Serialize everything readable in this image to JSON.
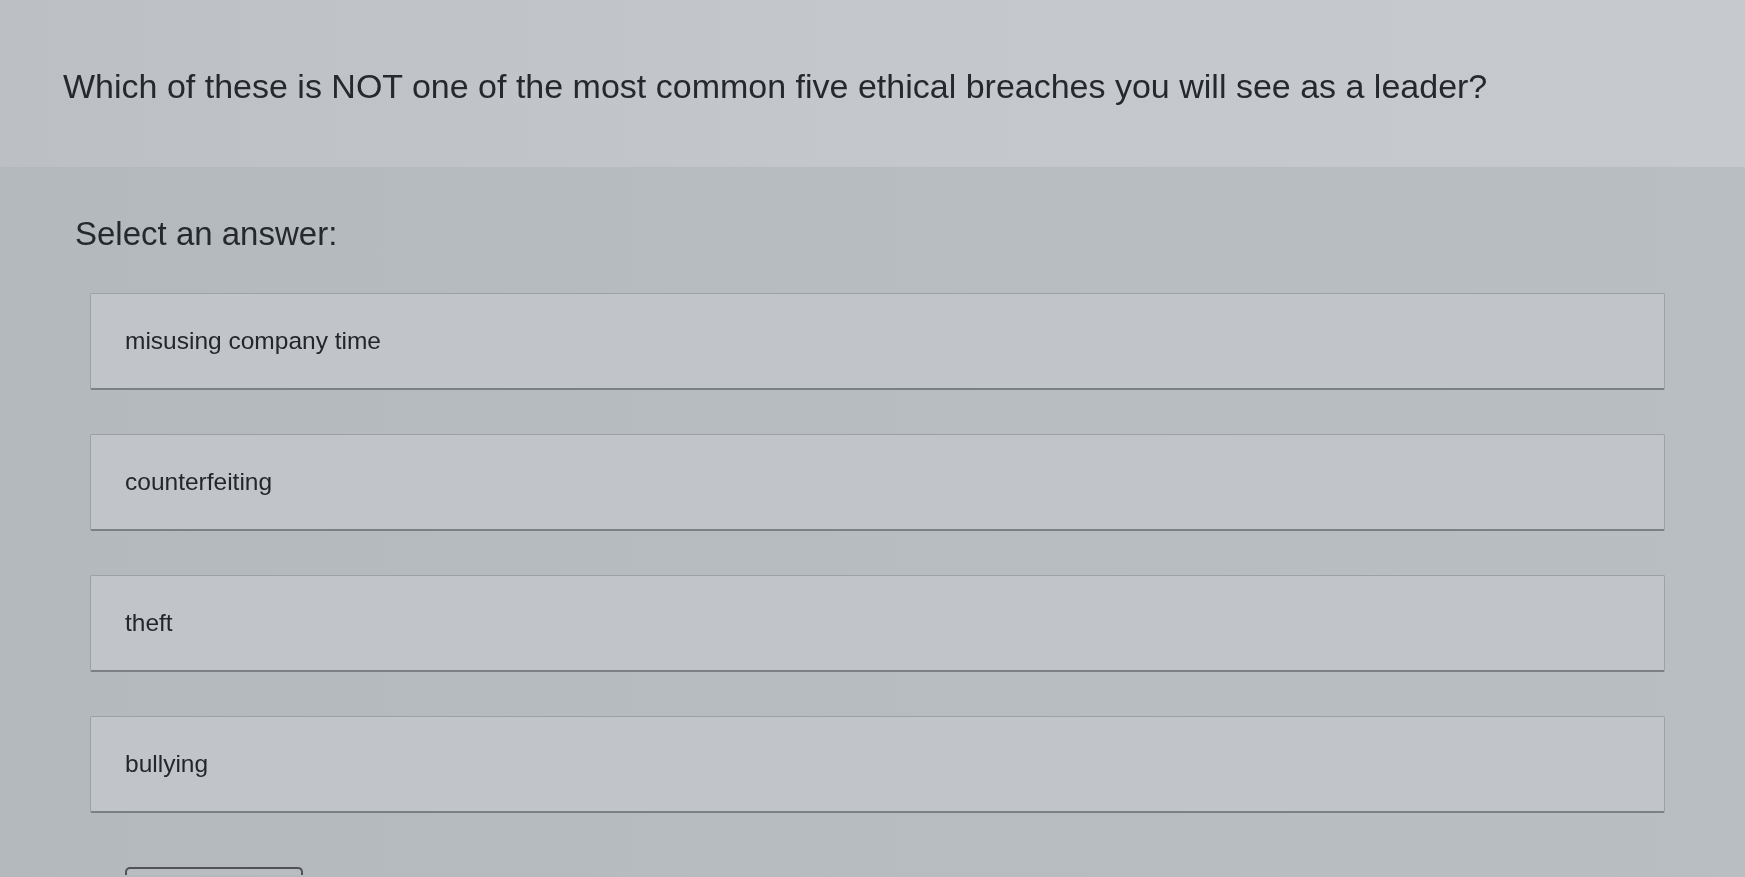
{
  "question": "Which of these is NOT one of the most common five ethical breaches you will see as a leader?",
  "prompt": "Select an answer:",
  "options": [
    {
      "label": "misusing company time",
      "selected": false
    },
    {
      "label": "counterfeiting",
      "selected": false
    },
    {
      "label": "theft",
      "selected": false
    },
    {
      "label": "bullying",
      "selected": false
    }
  ]
}
